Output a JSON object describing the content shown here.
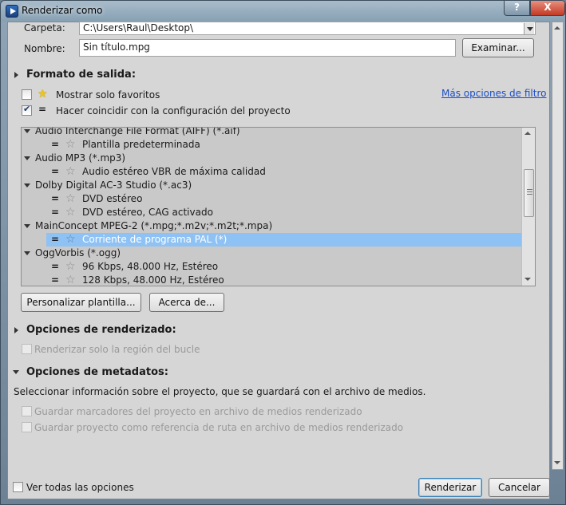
{
  "window": {
    "title": "Renderizar como",
    "help": "?",
    "close": "X"
  },
  "folder": {
    "label": "Carpeta:",
    "value": "C:\\Users\\Raul\\Desktop\\"
  },
  "name": {
    "label": "Nombre:",
    "value": "Sin título.mpg"
  },
  "browse_label": "Examinar...",
  "output_format": {
    "heading": "Formato de salida:",
    "favorites_only": {
      "label": "Mostrar solo favoritos",
      "checked": false
    },
    "match_project": {
      "label": "Hacer coincidir con la configuración del proyecto",
      "checked": true
    },
    "more_filter_options": "Más opciones de filtro",
    "formats": [
      {
        "name": "Audio Interchange File Format (AIFF) (*.aif)",
        "templates": [
          "Plantilla predeterminada"
        ]
      },
      {
        "name": "Audio MP3 (*.mp3)",
        "templates": [
          "Audio estéreo VBR de máxima calidad"
        ]
      },
      {
        "name": "Dolby Digital AC-3 Studio (*.ac3)",
        "templates": [
          "DVD estéreo",
          "DVD estéreo, CAG activado"
        ]
      },
      {
        "name": "MainConcept MPEG-2 (*.mpg;*.m2v;*.m2t;*.mpa)",
        "templates": [
          "Corriente de programa PAL (*)"
        ]
      },
      {
        "name": "OggVorbis (*.ogg)",
        "templates": [
          "96 Kbps, 48.000 Hz, Estéreo",
          "128 Kbps, 48.000 Hz, Estéreo"
        ]
      }
    ],
    "customize_label": "Personalizar plantilla...",
    "about_label": "Acerca de..."
  },
  "render_options": {
    "heading": "Opciones de renderizado:",
    "loop_region": "Renderizar solo la región del bucle"
  },
  "metadata_options": {
    "heading": "Opciones de metadatos:",
    "description": "Seleccionar información sobre el proyecto, que se guardará con el archivo de medios.",
    "save_markers": "Guardar marcadores del proyecto en archivo de medios renderizado",
    "save_path_ref": "Guardar proyecto como referencia de ruta en archivo de medios renderizado"
  },
  "show_all_options": "Ver todas las opciones",
  "render_label": "Renderizar",
  "cancel_label": "Cancelar",
  "colors": {
    "selection": "#8fc2f4",
    "link": "#1b4fc8"
  }
}
